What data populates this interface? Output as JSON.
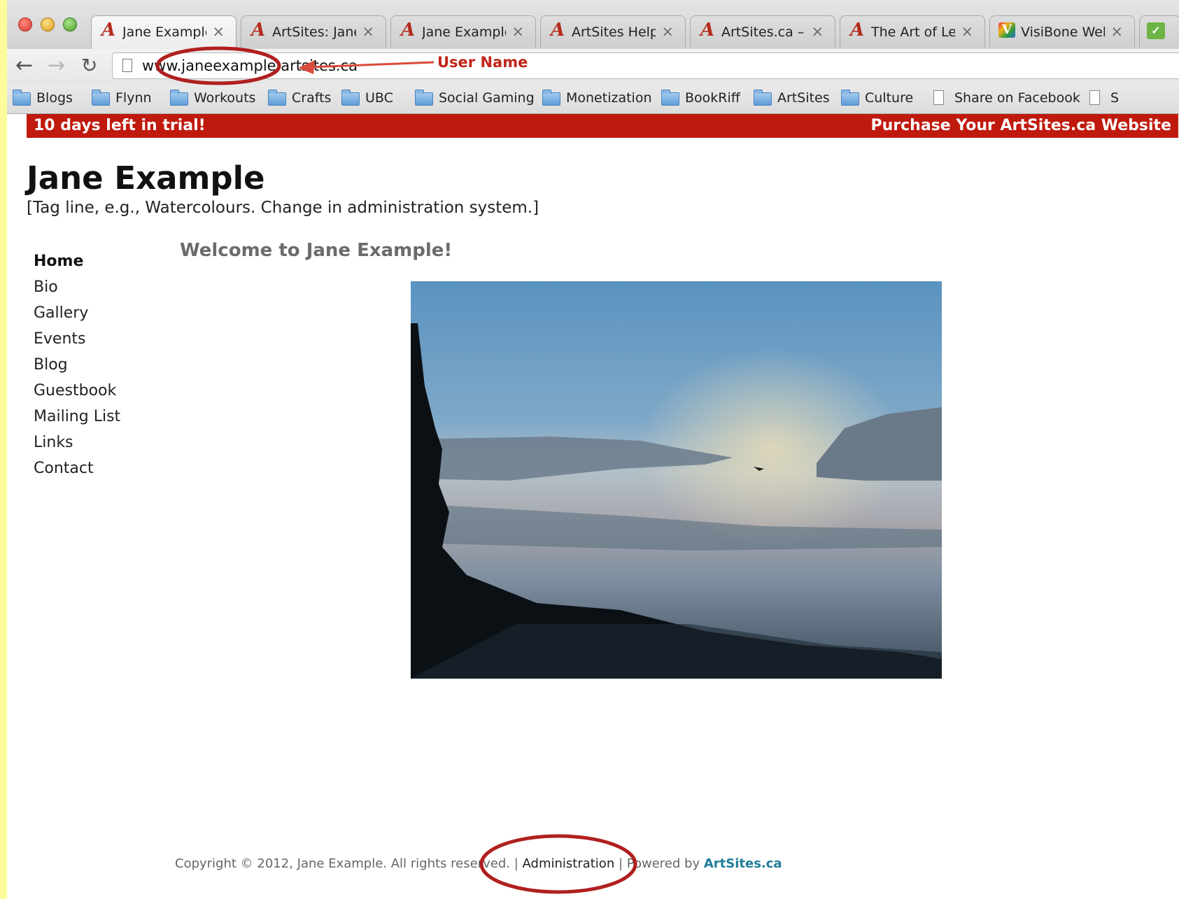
{
  "browser": {
    "tabs": [
      {
        "title": "Jane Example",
        "icon": "artsites-favicon",
        "active": true
      },
      {
        "title": "ArtSites: Jane E",
        "icon": "artsites-favicon",
        "active": false
      },
      {
        "title": "Jane Example",
        "icon": "artsites-favicon",
        "active": false
      },
      {
        "title": "ArtSites Help a",
        "icon": "artsites-favicon",
        "active": false
      },
      {
        "title": "ArtSites.ca – Si",
        "icon": "artsites-favicon",
        "active": false
      },
      {
        "title": "The Art of Leo",
        "icon": "artsites-favicon",
        "active": false
      },
      {
        "title": "VisiBone Webm",
        "icon": "visibone-favicon",
        "active": false
      }
    ],
    "tab_close_glyph": "×",
    "url": "www.janeexample.artsites.ca",
    "bookmarks": [
      {
        "label": "Blogs",
        "type": "folder"
      },
      {
        "label": "Flynn",
        "type": "folder"
      },
      {
        "label": "Workouts",
        "type": "folder"
      },
      {
        "label": "Crafts",
        "type": "folder"
      },
      {
        "label": "UBC",
        "type": "folder"
      },
      {
        "label": "Social Gaming",
        "type": "folder"
      },
      {
        "label": "Monetization",
        "type": "folder"
      },
      {
        "label": "BookRiff",
        "type": "folder"
      },
      {
        "label": "ArtSites",
        "type": "folder"
      },
      {
        "label": "Culture",
        "type": "folder"
      },
      {
        "label": "Share on Facebook",
        "type": "page"
      },
      {
        "label": "S",
        "type": "page"
      }
    ]
  },
  "banner": {
    "trial_text": "10 days left in trial!",
    "purchase_text": "Purchase Your ArtSites.ca Website",
    "color": "#c0190d"
  },
  "site": {
    "title": "Jane Example",
    "tagline": "[Tag line, e.g., Watercolours. Change in administration system.]",
    "welcome": "Welcome to Jane Example!",
    "nav": [
      "Home",
      "Bio",
      "Gallery",
      "Events",
      "Blog",
      "Guestbook",
      "Mailing List",
      "Links",
      "Contact"
    ],
    "current_nav": "Home"
  },
  "footer": {
    "copyright": "Copyright © 2012, Jane Example. All rights reserved.",
    "separator": "|",
    "admin_link": "Administration",
    "powered_by": "Powered by",
    "brand_link": "ArtSites.ca"
  },
  "annotations": {
    "user_name_label": "User Name",
    "color": "#c0251a"
  }
}
